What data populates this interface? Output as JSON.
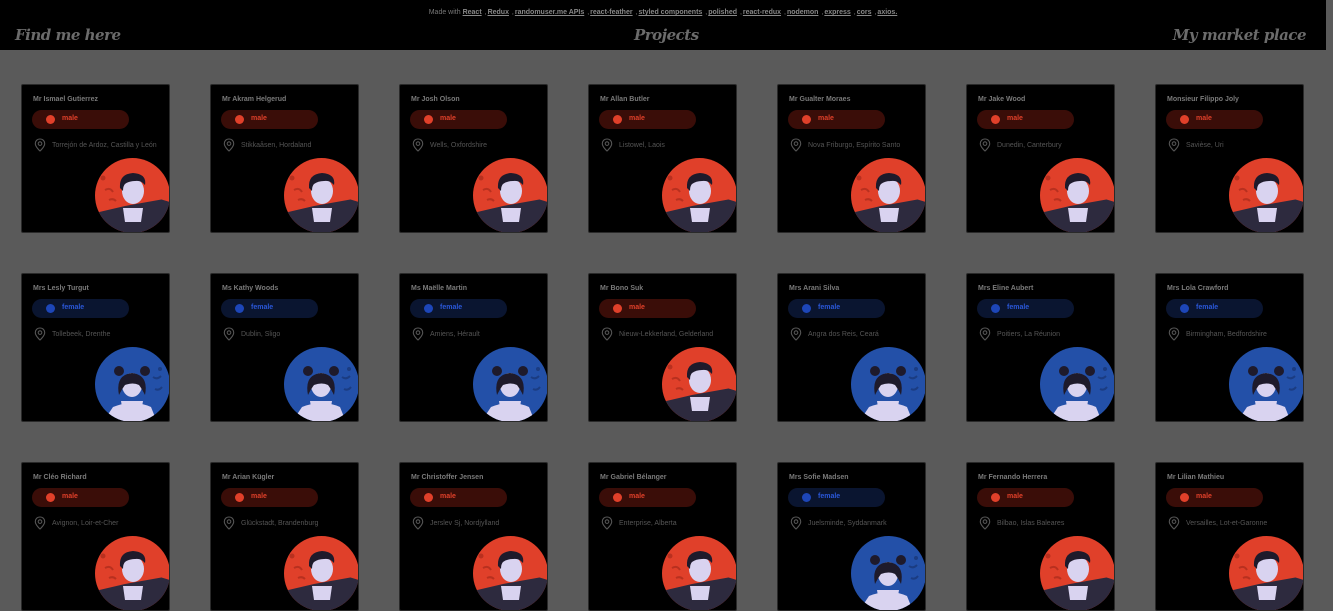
{
  "header": {
    "made_with_label": "Made with",
    "credits": [
      "React",
      "Redux",
      "randomuser.me APIs",
      "react-feather",
      "styled components",
      "polished",
      "react-redux",
      "nodemon",
      "express",
      "cors",
      "axios."
    ],
    "nav_left": "Find me here",
    "nav_center": "Projects",
    "nav_right": "My market place"
  },
  "colors": {
    "male_accent": "#e0402a",
    "female_accent": "#1d46b8",
    "card_bg": "#000000",
    "page_bg": "#5a5a5a"
  },
  "icons": {
    "location": "map-pin-icon",
    "avatar_male": "male-avatar-illustration",
    "avatar_female": "female-avatar-illustration"
  },
  "users": [
    {
      "name": "Mr Ismael Gutierrez",
      "gender": "male",
      "location": "Torrejón de Ardoz, Castilla y León"
    },
    {
      "name": "Mr Akram Helgerud",
      "gender": "male",
      "location": "Stikkaåsen, Hordaland"
    },
    {
      "name": "Mr Josh Olson",
      "gender": "male",
      "location": "Wells, Oxfordshire"
    },
    {
      "name": "Mr Allan Butler",
      "gender": "male",
      "location": "Listowel, Laois"
    },
    {
      "name": "Mr Gualter Moraes",
      "gender": "male",
      "location": "Nova Friburgo, Espírito Santo"
    },
    {
      "name": "Mr Jake Wood",
      "gender": "male",
      "location": "Dunedin, Canterbury"
    },
    {
      "name": "Monsieur Filippo Joly",
      "gender": "male",
      "location": "Savièse, Uri"
    },
    {
      "name": "Mrs Lesly Turgut",
      "gender": "female",
      "location": "Tollebeek, Drenthe"
    },
    {
      "name": "Ms Kathy Woods",
      "gender": "female",
      "location": "Dublin, Sligo"
    },
    {
      "name": "Ms Maëlle Martin",
      "gender": "female",
      "location": "Amiens, Hérault"
    },
    {
      "name": "Mr Bono Suk",
      "gender": "male",
      "location": "Nieuw-Lekkerland, Gelderland"
    },
    {
      "name": "Mrs Arani Silva",
      "gender": "female",
      "location": "Angra dos Reis, Ceará"
    },
    {
      "name": "Mrs Eline Aubert",
      "gender": "female",
      "location": "Poitiers, La Réunion"
    },
    {
      "name": "Mrs Lola Crawford",
      "gender": "female",
      "location": "Birmingham, Bedfordshire"
    },
    {
      "name": "Mr Cléo Richard",
      "gender": "male",
      "location": "Avignon, Loir-et-Cher"
    },
    {
      "name": "Mr Arian Kügler",
      "gender": "male",
      "location": "Glückstadt, Brandenburg"
    },
    {
      "name": "Mr Christoffer Jensen",
      "gender": "male",
      "location": "Jerslev Sj, Nordjylland"
    },
    {
      "name": "Mr Gabriel Bélanger",
      "gender": "male",
      "location": "Enterprise, Alberta"
    },
    {
      "name": "Mrs Sofie Madsen",
      "gender": "female",
      "location": "Juelsminde, Syddanmark"
    },
    {
      "name": "Mr Fernando Herrera",
      "gender": "male",
      "location": "Bilbao, Islas Baleares"
    },
    {
      "name": "Mr Lilian Mathieu",
      "gender": "male",
      "location": "Versailles, Lot-et-Garonne"
    }
  ]
}
